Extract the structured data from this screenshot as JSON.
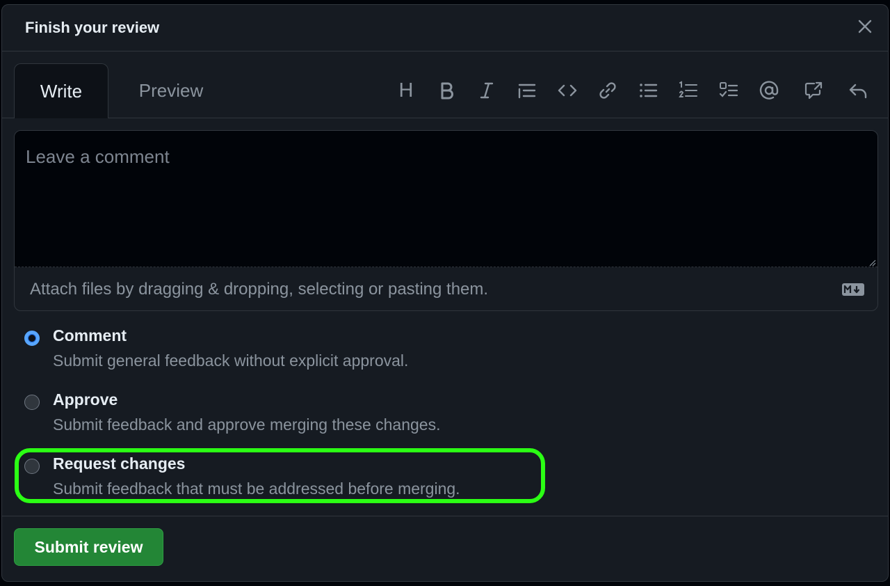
{
  "dialog": {
    "title": "Finish your review"
  },
  "tabs": [
    {
      "label": "Write",
      "active": true
    },
    {
      "label": "Preview",
      "active": false
    }
  ],
  "toolbar": {
    "icons": [
      "heading-icon",
      "bold-icon",
      "italic-icon",
      "quote-icon",
      "code-icon",
      "link-icon",
      "unordered-list-icon",
      "ordered-list-icon",
      "task-list-icon",
      "mention-icon",
      "cross-reference-icon",
      "saved-reply-icon"
    ],
    "heading_glyph": "H"
  },
  "editor": {
    "placeholder": "Leave a comment",
    "value": "",
    "attach_hint": "Attach files by dragging & dropping, selecting or pasting them."
  },
  "options": [
    {
      "title": "Comment",
      "description": "Submit general feedback without explicit approval.",
      "checked": true
    },
    {
      "title": "Approve",
      "description": "Submit feedback and approve merging these changes.",
      "checked": false
    },
    {
      "title": "Request changes",
      "description": "Submit feedback that must be addressed before merging.",
      "checked": false
    }
  ],
  "footer": {
    "submit_label": "Submit review"
  },
  "colors": {
    "accent_blue": "#58a6ff",
    "primary_green": "#238636",
    "highlight_green": "#2bff14",
    "background": "#161b22"
  }
}
